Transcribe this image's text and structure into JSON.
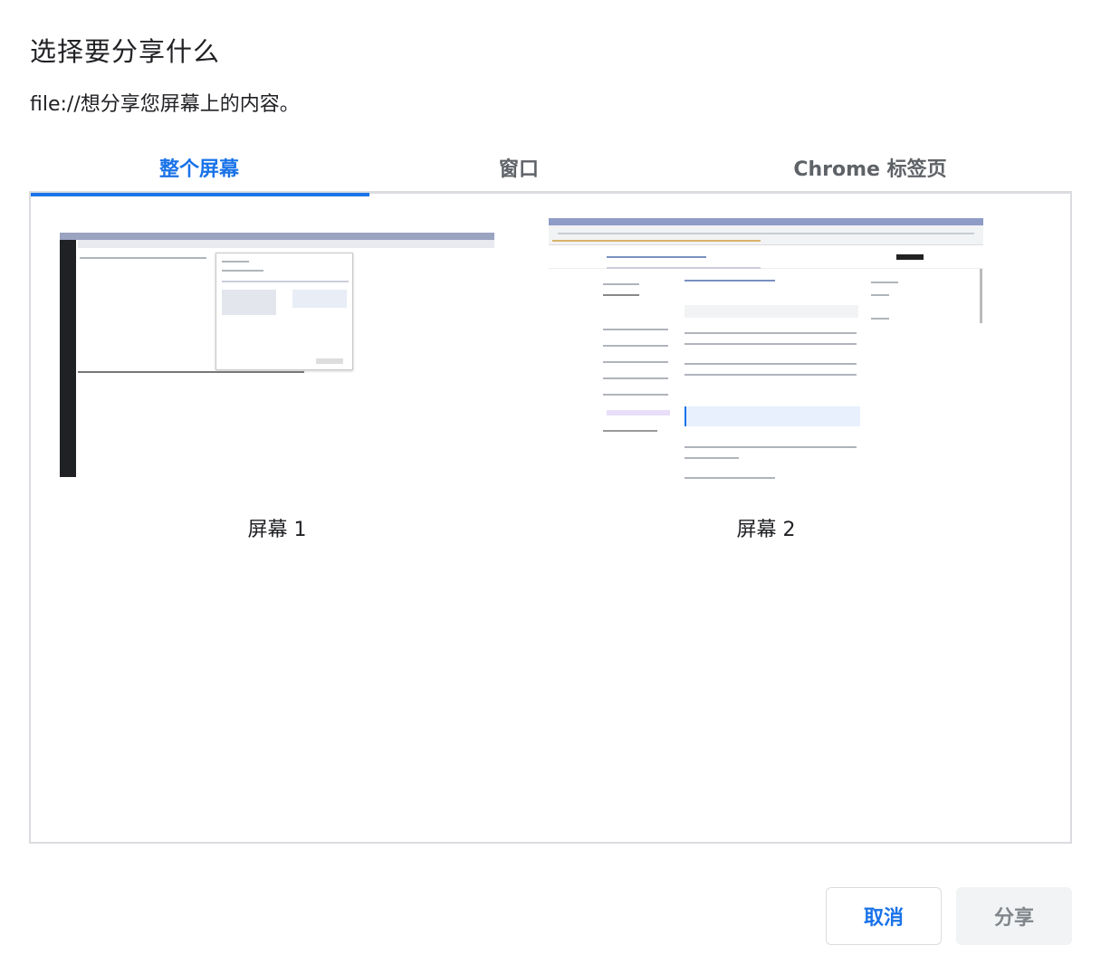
{
  "dialog": {
    "title": "选择要分享什么",
    "subtitle": "file://想分享您屏幕上的内容。"
  },
  "tabs": [
    {
      "label": "整个屏幕",
      "active": true
    },
    {
      "label": "窗口",
      "active": false
    },
    {
      "label": "Chrome 标签页",
      "active": false
    }
  ],
  "sources": [
    {
      "label": "屏幕 1"
    },
    {
      "label": "屏幕 2"
    }
  ],
  "buttons": {
    "cancel": "取消",
    "share": "分享"
  },
  "colors": {
    "accent": "#1a73e8",
    "disabled_text": "#80868b",
    "border": "#dadce0"
  }
}
